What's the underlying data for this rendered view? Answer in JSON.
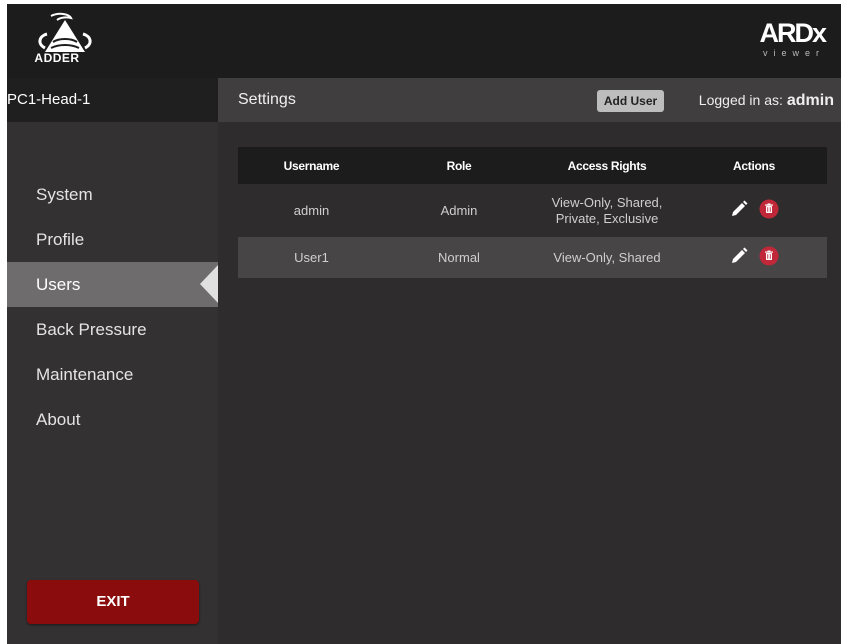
{
  "brand": {
    "adder_logo_text": "ADDER",
    "ardx_logo_text": "ARDx",
    "ardx_subtitle": "viewer"
  },
  "sidebar": {
    "device_name": "PC1-Head-1",
    "items": [
      {
        "label": "System",
        "active": false
      },
      {
        "label": "Profile",
        "active": false
      },
      {
        "label": "Users",
        "active": true
      },
      {
        "label": "Back Pressure",
        "active": false
      },
      {
        "label": "Maintenance",
        "active": false
      },
      {
        "label": "About",
        "active": false
      }
    ],
    "exit_label": "EXIT"
  },
  "header": {
    "title": "Settings",
    "add_user_label": "Add User",
    "logged_in_prefix": "Logged in as:",
    "logged_in_user": "admin"
  },
  "table": {
    "columns": [
      "Username",
      "Role",
      "Access Rights",
      "Actions"
    ],
    "rows": [
      {
        "username": "admin",
        "role": "Admin",
        "access_line1": "View-Only, Shared,",
        "access_line2": "Private, Exclusive"
      },
      {
        "username": "User1",
        "role": "Normal",
        "access_line1": "View-Only, Shared",
        "access_line2": ""
      }
    ]
  },
  "icons": {
    "edit": "pencil-icon",
    "delete": "trash-icon"
  },
  "colors": {
    "exit_button": "#8b0c0c",
    "delete_icon": "#c0283a",
    "active_nav": "#6e6c6d"
  }
}
